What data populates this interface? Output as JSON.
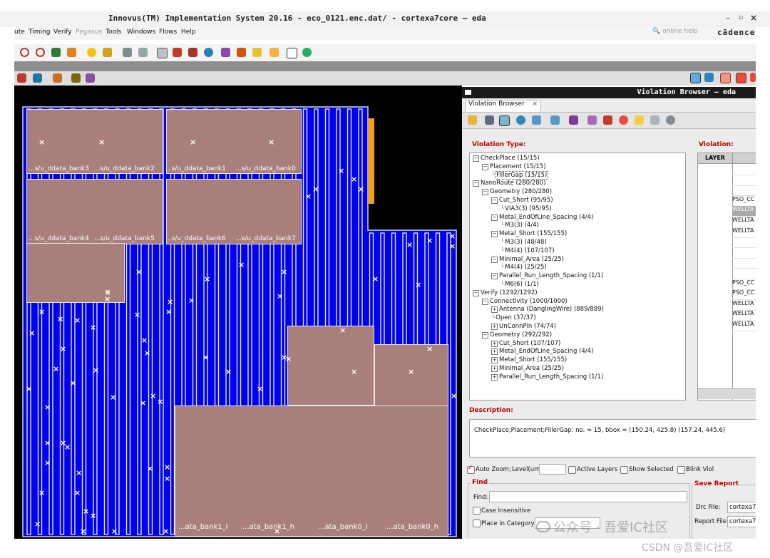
{
  "window": {
    "title": "Innovus(TM) Implementation System 20.16 - eco_0121.enc.dat/ - cortexa7core — eda",
    "controls": [
      "–",
      "▫",
      "×"
    ]
  },
  "menubar": {
    "items": [
      "ute",
      "Timing",
      "Verify",
      "Pegasus",
      "Tools",
      "Windows",
      "Flows",
      "Help"
    ],
    "disabled": [
      "Pegasus"
    ],
    "search_placeholder": "online help",
    "brand": "cādence"
  },
  "canvas": {
    "cell_labels_top": [
      "...s/u_ddata_bank3",
      "...s/u_ddata_bank2",
      "...s/u_ddata_bank1",
      "...s/u_ddata_bank0"
    ],
    "cell_labels_mid": [
      "...s/u_ddata_bank4",
      "...s/u_ddata_bank5",
      "...s/u_ddata_bank6",
      "...s/u_ddata_bank7"
    ],
    "cell_labels_bottom": [
      "...ata_bank1_l",
      "...ata_bank1_h",
      "...ata_bank0_l",
      "...ata_bank0_h"
    ],
    "marker": "×",
    "colors": {
      "background": "#000000",
      "core": "#0000f0",
      "cell": "#a97f7b",
      "highlight": "#f0a020"
    }
  },
  "violation_browser": {
    "window_title": "Violation Browser — eda",
    "tab_label": "Violation Browser",
    "tab_close": "×",
    "violation_type_label": "Violation Type:",
    "violation_label": "Violation:",
    "tree": [
      {
        "label": "CheckPlace (15/15)",
        "toggle": "⊟",
        "indent": 0
      },
      {
        "label": "Placement (15/15)",
        "toggle": "⊟",
        "indent": 1
      },
      {
        "label": "FillerGap (15/15)",
        "toggle": "",
        "indent": 2,
        "selected": true
      },
      {
        "label": "NanoRoute (280/280)",
        "toggle": "⊟",
        "indent": 0
      },
      {
        "label": "Geometry (280/280)",
        "toggle": "⊟",
        "indent": 1
      },
      {
        "label": "Cut_Short (95/95)",
        "toggle": "⊟",
        "indent": 2
      },
      {
        "label": "VIA3(3) (95/95)",
        "toggle": "",
        "indent": 3
      },
      {
        "label": "Metal_EndOfLine_Spacing (4/4)",
        "toggle": "⊟",
        "indent": 2
      },
      {
        "label": "M3(3) (4/4)",
        "toggle": "",
        "indent": 3
      },
      {
        "label": "Metal_Short (155/155)",
        "toggle": "⊟",
        "indent": 2
      },
      {
        "label": "M3(3) (48/48)",
        "toggle": "",
        "indent": 3
      },
      {
        "label": "M4(4) (107/107)",
        "toggle": "",
        "indent": 3
      },
      {
        "label": "Minimal_Area (25/25)",
        "toggle": "⊟",
        "indent": 2
      },
      {
        "label": "M4(4) (25/25)",
        "toggle": "",
        "indent": 3
      },
      {
        "label": "Parallel_Run_Length_Spacing (1/1)",
        "toggle": "⊟",
        "indent": 2
      },
      {
        "label": "M6(6) (1/1)",
        "toggle": "",
        "indent": 3
      },
      {
        "label": "Verify (1292/1292)",
        "toggle": "⊟",
        "indent": 0
      },
      {
        "label": "Connectivity (1000/1000)",
        "toggle": "⊟",
        "indent": 1
      },
      {
        "label": "Antenna (DanglingWire) (889/889)",
        "toggle": "⊞",
        "indent": 2
      },
      {
        "label": "Open (37/37)",
        "toggle": "",
        "indent": 2
      },
      {
        "label": "UnConnPin (74/74)",
        "toggle": "⊞",
        "indent": 2
      },
      {
        "label": "Geometry (292/292)",
        "toggle": "⊟",
        "indent": 1
      },
      {
        "label": "Cut_Short (107/107)",
        "toggle": "⊞",
        "indent": 2
      },
      {
        "label": "Metal_EndOfLine_Spacing (4/4)",
        "toggle": "⊞",
        "indent": 2
      },
      {
        "label": "Metal_Short (155/155)",
        "toggle": "⊞",
        "indent": 2
      },
      {
        "label": "Minimal_Area (25/25)",
        "toggle": "⊞",
        "indent": 2
      },
      {
        "label": "Parallel_Run_Length_Spacing (1/1)",
        "toggle": "⊞",
        "indent": 2
      }
    ],
    "table": {
      "column_header": "LAYER",
      "rows": [
        "",
        "",
        "",
        "PSO_CC",
        "WELLTA",
        "WELLTA",
        "WELLTA",
        "",
        "",
        "",
        "",
        "PSO_CC",
        "PSO_CC",
        "WELLTA",
        "WELLTA",
        "WELLTA"
      ],
      "highlighted_row": 4
    },
    "description_label": "Description:",
    "description_text": "CheckPlace;Placement;FillerGap: no. = 15, bbox = (150.24, 425.8) (157.24, 445.6)",
    "options": {
      "auto_zoom": "Auto Zoom;",
      "level": "Level(um)",
      "active_layers": "Active Layers",
      "show_selected": "Show Selected",
      "blink_viol": "Blink Viol"
    },
    "find": {
      "group_label": "Find",
      "find_label": "Find:",
      "case_insensitive": "Case Insensitive",
      "place_in_category": "Place in Category"
    },
    "save_report": {
      "group_label": "Save Report",
      "drc_file_label": "Drc File:",
      "drc_file_value": "cortexa7",
      "report_file_label": "Report File:",
      "report_file_value": "cortexa7"
    }
  },
  "watermark": {
    "line1": "公众号 · 吾爱IC社区",
    "line2": "CSDN @吾爱IC社区"
  }
}
